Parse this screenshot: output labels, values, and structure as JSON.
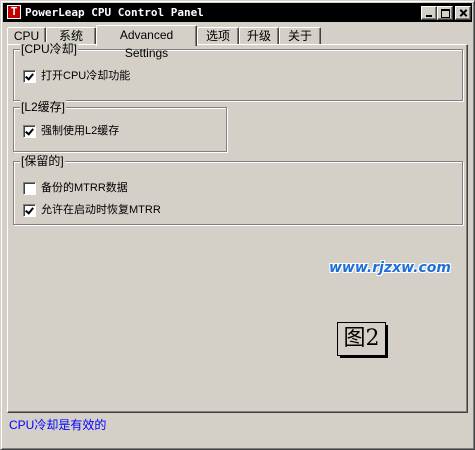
{
  "window": {
    "title": "PowerLeap CPU Control Panel",
    "icon_letter": "T"
  },
  "colors": {
    "face": "#d4d0c8",
    "titlebar": "#000000",
    "status_text": "#0000ff",
    "watermark": "#1e6fd9"
  },
  "tabs": [
    {
      "label": "CPU"
    },
    {
      "label": "系统"
    },
    {
      "label": "Advanced Settings",
      "active": true
    },
    {
      "label": "选项"
    },
    {
      "label": "升级"
    },
    {
      "label": "关于"
    }
  ],
  "groups": {
    "cpu_cooling": {
      "title": "[CPU冷却]",
      "options": [
        {
          "label": "打开CPU冷却功能",
          "checked": true
        }
      ]
    },
    "l2_cache": {
      "title": "[L2缓存]",
      "options": [
        {
          "label": "强制使用L2缓存",
          "checked": true
        }
      ]
    },
    "preserved": {
      "title": "[保留的]",
      "options": [
        {
          "label": "备份的MTRR数据",
          "checked": false
        },
        {
          "label": "允许在启动时恢复MTRR",
          "checked": true
        }
      ]
    }
  },
  "watermark": "www.rjzxw.com",
  "figure_label": "图2",
  "status": "CPU冷却是有效的"
}
